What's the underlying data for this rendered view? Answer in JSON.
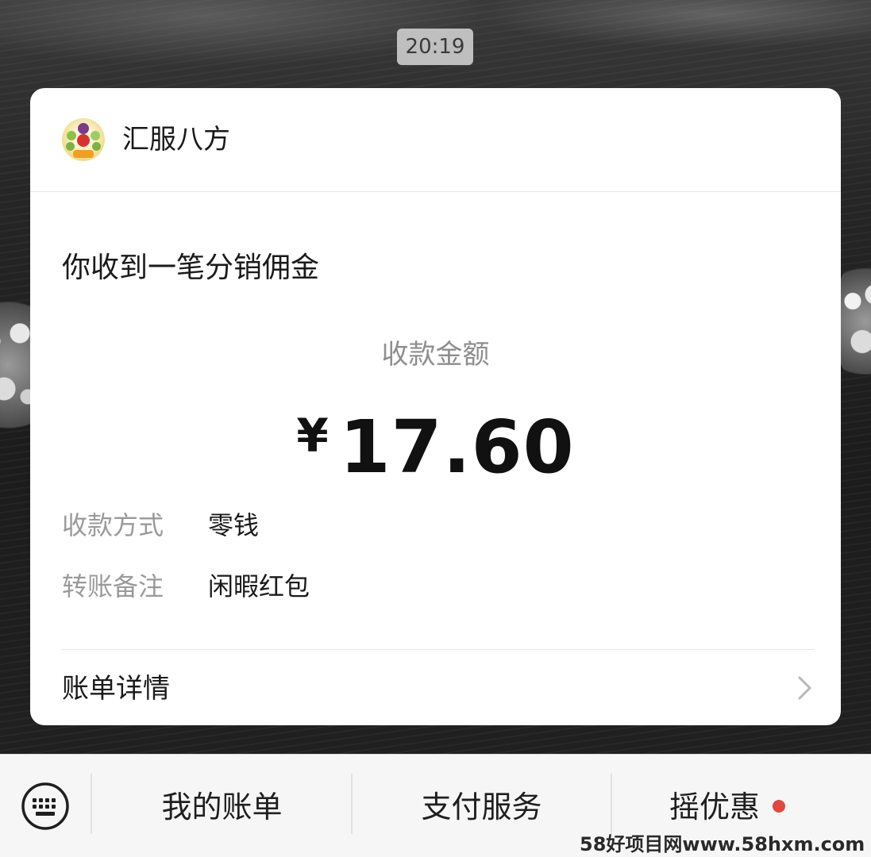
{
  "time": "20:19",
  "card": {
    "merchant_name": "汇服八方",
    "avatar_icon": "fruit-logo-icon",
    "title": "你收到一笔分销佣金",
    "amount_label": "收款金额",
    "currency": "¥",
    "amount": "17.60",
    "details": [
      {
        "label": "收款方式",
        "value": "零钱"
      },
      {
        "label": "转账备注",
        "value": "闲暇红包"
      }
    ],
    "bill_details_label": "账单详情",
    "bill_details_icon": "chevron-right-icon"
  },
  "bottom_menu": {
    "keyboard_icon": "keyboard-icon",
    "items": [
      {
        "label": "我的账单"
      },
      {
        "label": "支付服务"
      },
      {
        "label": "摇优惠",
        "badge_color": "#e0473f"
      }
    ]
  },
  "watermark": "58好项目网www.58hxm.com"
}
